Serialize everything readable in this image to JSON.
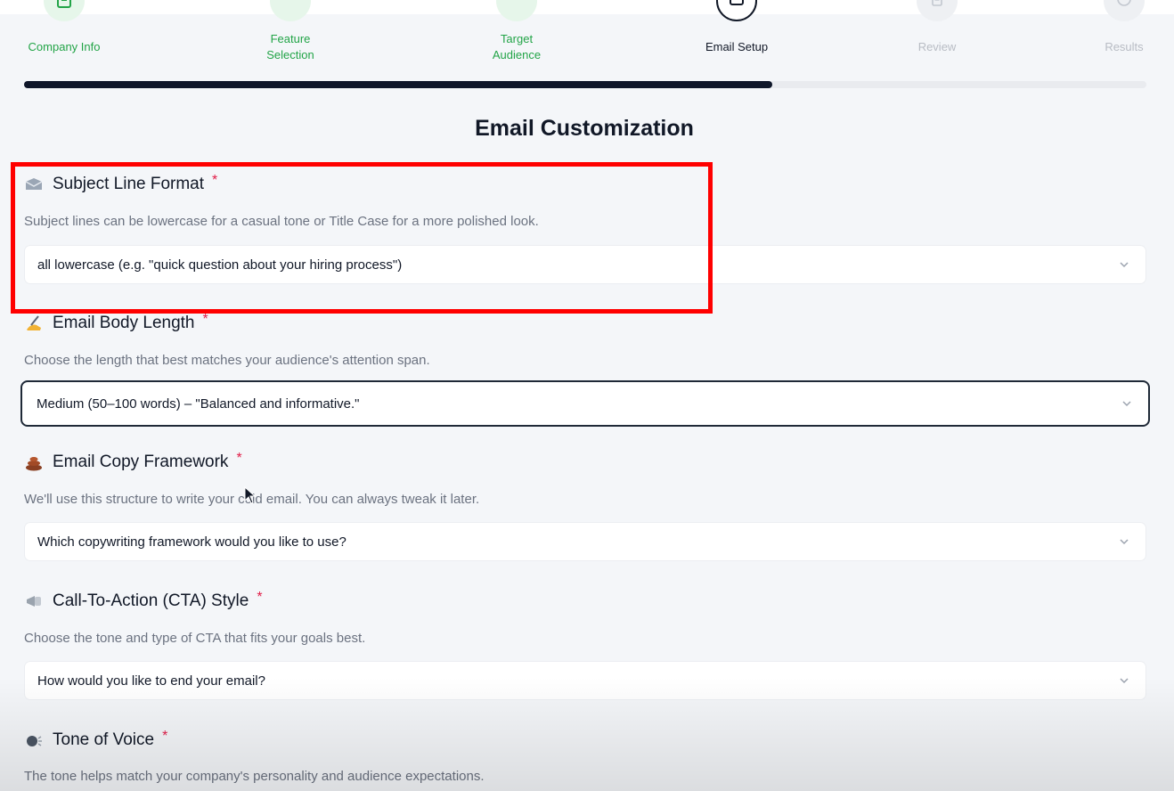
{
  "stepper": {
    "steps": [
      {
        "label": "Company Info",
        "state": "done",
        "icon": "building-icon"
      },
      {
        "label": "Feature\nSelection",
        "state": "done",
        "icon": "check-icon"
      },
      {
        "label": "Target\nAudience",
        "state": "done",
        "icon": "check-icon"
      },
      {
        "label": "Email Setup",
        "state": "active",
        "icon": "mail-icon"
      },
      {
        "label": "Review",
        "state": "todo",
        "icon": "document-icon"
      },
      {
        "label": "Results",
        "state": "todo",
        "icon": "circle-icon"
      }
    ],
    "progress": 0.667,
    "colors": {
      "done": "#22a447",
      "active": "#111827",
      "todo": "#b8bcc4",
      "progress": "#0f172a"
    }
  },
  "page": {
    "title": "Email Customization"
  },
  "fields": {
    "subject": {
      "icon": "envelope-icon",
      "label": "Subject Line Format",
      "required": "*",
      "help": "Subject lines can be lowercase for a casual tone or Title Case for a more polished look.",
      "value": "all lowercase (e.g. \"quick question about your hiring process\")"
    },
    "body_length": {
      "icon": "writing-hand-icon",
      "label": "Email Body Length",
      "required": "*",
      "help": "Choose the length that best matches your audience's attention span.",
      "value": "Medium (50–100 words) – \"Balanced and informative.\""
    },
    "framework": {
      "icon": "poop-icon",
      "label": "Email Copy Framework",
      "required": "*",
      "help": "We'll use this structure to write your cold email. You can always tweak it later.",
      "placeholder": "Which copywriting framework would you like to use?"
    },
    "cta": {
      "icon": "megaphone-icon",
      "label": "Call-To-Action (CTA) Style",
      "required": "*",
      "help": "Choose the tone and type of CTA that fits your goals best.",
      "placeholder": "How would you like to end your email?"
    },
    "tone": {
      "icon": "speaking-head-icon",
      "label": "Tone of Voice",
      "required": "*",
      "help": "The tone helps match your company's personality and audience expectations."
    }
  },
  "colors": {
    "required": "#e11d48",
    "annotation": "#ff0000",
    "help": "#6b7280"
  }
}
